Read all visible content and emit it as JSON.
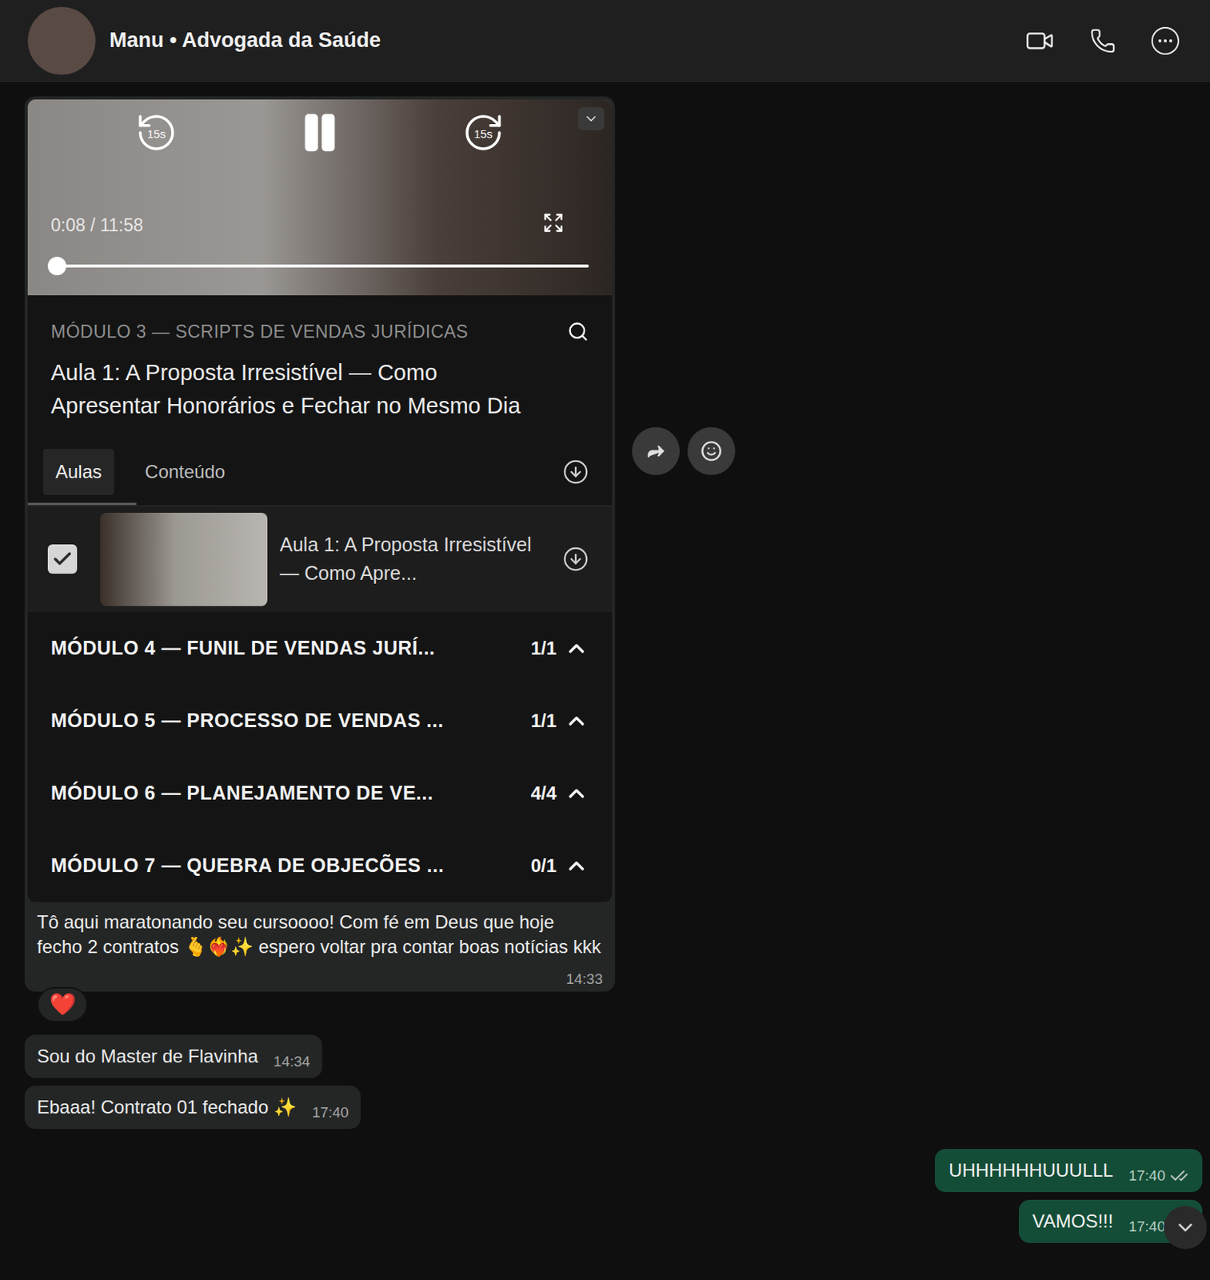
{
  "header": {
    "title": "Manu • Advogada da Saúde"
  },
  "messages": [
    {
      "kind": "media",
      "outgoing": false,
      "player": {
        "rewind": "15s",
        "forward": "15s",
        "time": "0:08 / 11:58",
        "level": 0.011
      },
      "course": {
        "module": "MÓDULO 3 — SCRIPTS DE VENDAS JURÍDICAS",
        "lesson": "Aula 1: A Proposta Irresistível — Como Apresentar Honorários e Fechar no Mesmo Dia",
        "tabs": [
          {
            "label": "Aulas",
            "selected": true
          },
          {
            "label": "Conteúdo",
            "selected": false
          }
        ],
        "lessons": [
          {
            "title": "Aula 1: A Proposta Irresistível — Como Apre...",
            "checked": true
          }
        ],
        "modules": [
          {
            "title": "MÓDULO 4 — FUNIL DE VENDAS JURÍ...",
            "count": "1/1"
          },
          {
            "title": "MÓDULO 5 — PROCESSO DE VENDAS ...",
            "count": "1/1"
          },
          {
            "title": "MÓDULO 6 — PLANEJAMENTO DE VE...",
            "count": "4/4"
          },
          {
            "title": "MÓDULO 7 — QUEBRA DE OBJECÕES ...",
            "count": "0/1"
          }
        ]
      },
      "caption": "Tô aqui maratonando seu cursoooo! Com fé em Deus que hoje fecho 2 contratos 🫰❤️‍🔥✨ espero voltar pra contar boas notícias kkk",
      "time": "14:33",
      "reaction": "❤️"
    },
    {
      "kind": "text",
      "outgoing": false,
      "text": "Sou do Master de Flavinha",
      "time": "14:34"
    },
    {
      "kind": "text",
      "outgoing": false,
      "text": "Ebaaa! Contrato 01 fechado ✨",
      "time": "17:40"
    },
    {
      "kind": "text",
      "outgoing": true,
      "text": "UHHHHHHUUULLL",
      "time": "17:40",
      "delivered": true
    },
    {
      "kind": "text",
      "outgoing": true,
      "text": "VAMOS!!!",
      "time": "17:40",
      "delivered": true
    }
  ]
}
